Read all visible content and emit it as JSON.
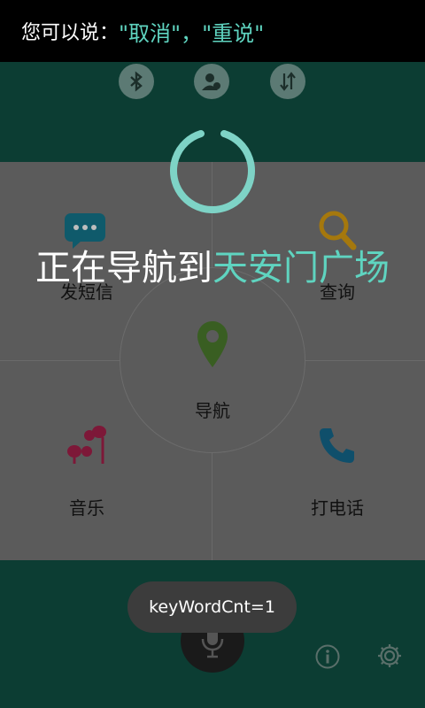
{
  "status": {
    "prompt_prefix": "您可以说：",
    "prompt_option1": "\"取消\"",
    "prompt_sep": "，",
    "prompt_option2": "\"重说\""
  },
  "quick_toggles": [
    {
      "icon": "bluetooth-icon"
    },
    {
      "icon": "contact-icon"
    },
    {
      "icon": "data-transfer-icon"
    }
  ],
  "grid": {
    "sms_label": "发短信",
    "search_label": "查询",
    "nav_label": "导航",
    "music_label": "音乐",
    "call_label": "打电话"
  },
  "overlay": {
    "nav_prefix": "正在导航到",
    "destination": "天安门广场"
  },
  "toast": {
    "text": "keyWordCnt=1"
  },
  "colors": {
    "accent": "#5fd4c0",
    "background": "#0c3d33"
  }
}
